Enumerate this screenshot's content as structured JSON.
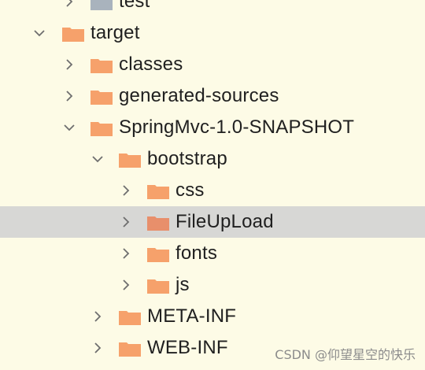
{
  "tree": {
    "items": [
      {
        "label": "test",
        "expanded": false,
        "folder_color": "#a9b3bd"
      },
      {
        "label": "target",
        "expanded": true,
        "folder_color": "#f6a16b"
      },
      {
        "label": "classes",
        "expanded": false,
        "folder_color": "#f6a16b"
      },
      {
        "label": "generated-sources",
        "expanded": false,
        "folder_color": "#f6a16b"
      },
      {
        "label": "SpringMvc-1.0-SNAPSHOT",
        "expanded": true,
        "folder_color": "#f6a16b"
      },
      {
        "label": "bootstrap",
        "expanded": true,
        "folder_color": "#f6a16b"
      },
      {
        "label": "css",
        "expanded": false,
        "folder_color": "#f6a16b"
      },
      {
        "label": "FileUpLoad",
        "expanded": false,
        "selected": true,
        "folder_color": "#e88f6b"
      },
      {
        "label": "fonts",
        "expanded": false,
        "folder_color": "#f6a16b"
      },
      {
        "label": "js",
        "expanded": false,
        "folder_color": "#f6a16b"
      },
      {
        "label": "META-INF",
        "expanded": false,
        "folder_color": "#f6a16b"
      },
      {
        "label": "WEB-INF",
        "expanded": false,
        "folder_color": "#f6a16b"
      }
    ]
  },
  "watermark": "CSDN @仰望星空的快乐",
  "colors": {
    "background": "#fdfbe6",
    "selection": "#d7d7d5",
    "chevron": "#6e6e6e",
    "text": "#202020"
  }
}
